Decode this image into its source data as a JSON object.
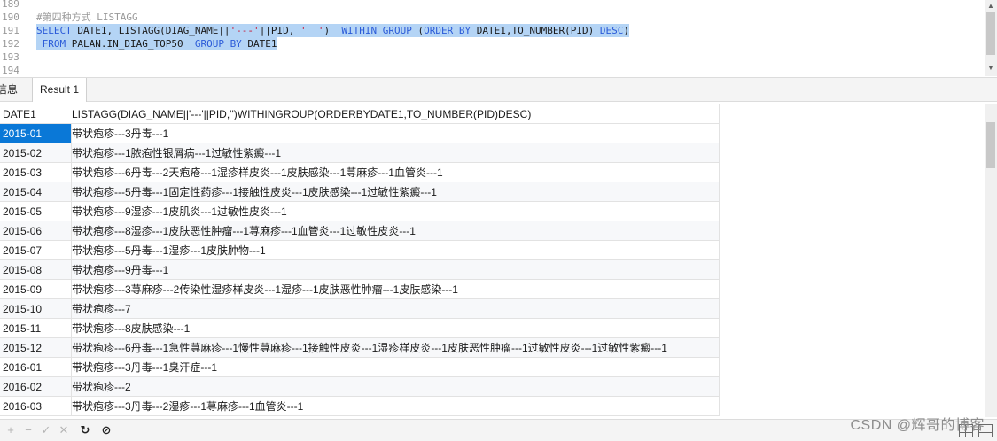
{
  "editor": {
    "lines": [
      {
        "no": "189",
        "segments": []
      },
      {
        "no": "190",
        "segments": [
          {
            "t": "#第四种方式 LISTAGG",
            "c": "cm"
          }
        ]
      },
      {
        "no": "191",
        "highlight": true,
        "segments": [
          {
            "t": "SELECT",
            "c": "kw"
          },
          {
            "t": " DATE1, LISTAGG(DIAG_NAME||",
            "c": "tx"
          },
          {
            "t": "'---'",
            "c": "st"
          },
          {
            "t": "||PID, ",
            "c": "tx"
          },
          {
            "t": "'  '",
            "c": "st"
          },
          {
            "t": ")  ",
            "c": "tx"
          },
          {
            "t": "WITHIN GROUP",
            "c": "kw"
          },
          {
            "t": " (",
            "c": "tx"
          },
          {
            "t": "ORDER BY",
            "c": "kw"
          },
          {
            "t": " DATE1,TO_NUMBER(PID) ",
            "c": "tx"
          },
          {
            "t": "DESC",
            "c": "kw"
          },
          {
            "t": ")",
            "c": "tx"
          }
        ]
      },
      {
        "no": "192",
        "highlight": true,
        "segments": [
          {
            "t": " FROM",
            "c": "kw"
          },
          {
            "t": " PALAN.IN_DIAG_TOP50  ",
            "c": "tx"
          },
          {
            "t": "GROUP BY",
            "c": "kw"
          },
          {
            "t": " DATE1",
            "c": "tx"
          }
        ]
      },
      {
        "no": "193",
        "segments": []
      },
      {
        "no": "194",
        "segments": []
      }
    ]
  },
  "tabs": {
    "info": "信息",
    "result": "Result 1"
  },
  "grid": {
    "headers": [
      "DATE1",
      "LISTAGG(DIAG_NAME||'---'||PID,'')WITHINGROUP(ORDERBYDATE1,TO_NUMBER(PID)DESC)"
    ],
    "rows": [
      [
        "2015-01",
        "带状疱疹---3丹毒---1"
      ],
      [
        "2015-02",
        "带状疱疹---1脓疱性银屑病---1过敏性紫癜---1"
      ],
      [
        "2015-03",
        "带状疱疹---6丹毒---2天疱疮---1湿疹样皮炎---1皮肤感染---1荨麻疹---1血管炎---1"
      ],
      [
        "2015-04",
        "带状疱疹---5丹毒---1固定性药疹---1接触性皮炎---1皮肤感染---1过敏性紫癜---1"
      ],
      [
        "2015-05",
        "带状疱疹---9湿疹---1皮肌炎---1过敏性皮炎---1"
      ],
      [
        "2015-06",
        "带状疱疹---8湿疹---1皮肤恶性肿瘤---1荨麻疹---1血管炎---1过敏性皮炎---1"
      ],
      [
        "2015-07",
        "带状疱疹---5丹毒---1湿疹---1皮肤肿物---1"
      ],
      [
        "2015-08",
        "带状疱疹---9丹毒---1"
      ],
      [
        "2015-09",
        "带状疱疹---3荨麻疹---2传染性湿疹样皮炎---1湿疹---1皮肤恶性肿瘤---1皮肤感染---1"
      ],
      [
        "2015-10",
        "带状疱疹---7"
      ],
      [
        "2015-11",
        "带状疱疹---8皮肤感染---1"
      ],
      [
        "2015-12",
        "带状疱疹---6丹毒---1急性荨麻疹---1慢性荨麻疹---1接触性皮炎---1湿疹样皮炎---1皮肤恶性肿瘤---1过敏性皮炎---1过敏性紫癜---1"
      ],
      [
        "2016-01",
        "带状疱疹---3丹毒---1臭汗症---1"
      ],
      [
        "2016-02",
        "带状疱疹---2"
      ],
      [
        "2016-03",
        "带状疱疹---3丹毒---2湿疹---1荨麻疹---1血管炎---1"
      ]
    ]
  },
  "toolbar": {
    "add": "+",
    "remove": "−",
    "apply": "✓",
    "cancel": "✕",
    "refresh": "↻",
    "stop": "⊘"
  },
  "watermark": "CSDN @辉哥的博客",
  "icons": [
    "scroll-up-icon",
    "scroll-down-icon",
    "add-row-icon",
    "remove-row-icon",
    "apply-icon",
    "cancel-icon",
    "refresh-icon",
    "stop-icon",
    "grid-view-icon",
    "form-view-icon"
  ]
}
